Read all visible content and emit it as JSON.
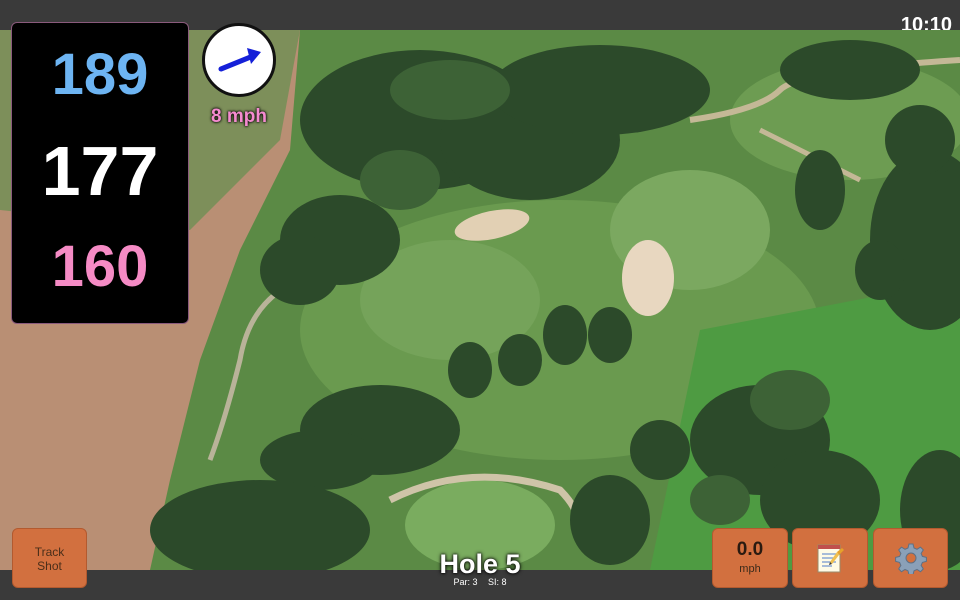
{
  "status_bar": {
    "time": "10:10"
  },
  "distances": {
    "back": "189",
    "middle": "177",
    "front": "160"
  },
  "wind": {
    "speed": "8 mph",
    "icon": "arrow-icon"
  },
  "buttons": {
    "track_shot_line1": "Track",
    "track_shot_line2": "Shot",
    "speed_value": "0.0",
    "speed_unit": "mph",
    "notes_icon": "notepad-icon",
    "settings_icon": "gear-icon"
  },
  "hole": {
    "title": "Hole 5",
    "par": "Par: 3",
    "si": "SI: 8"
  },
  "colors": {
    "back_distance": "#6db4f2",
    "middle_distance": "#ffffff",
    "front_distance": "#f58bc5",
    "button": "#d2703f",
    "wind_text": "#f58bd0"
  }
}
